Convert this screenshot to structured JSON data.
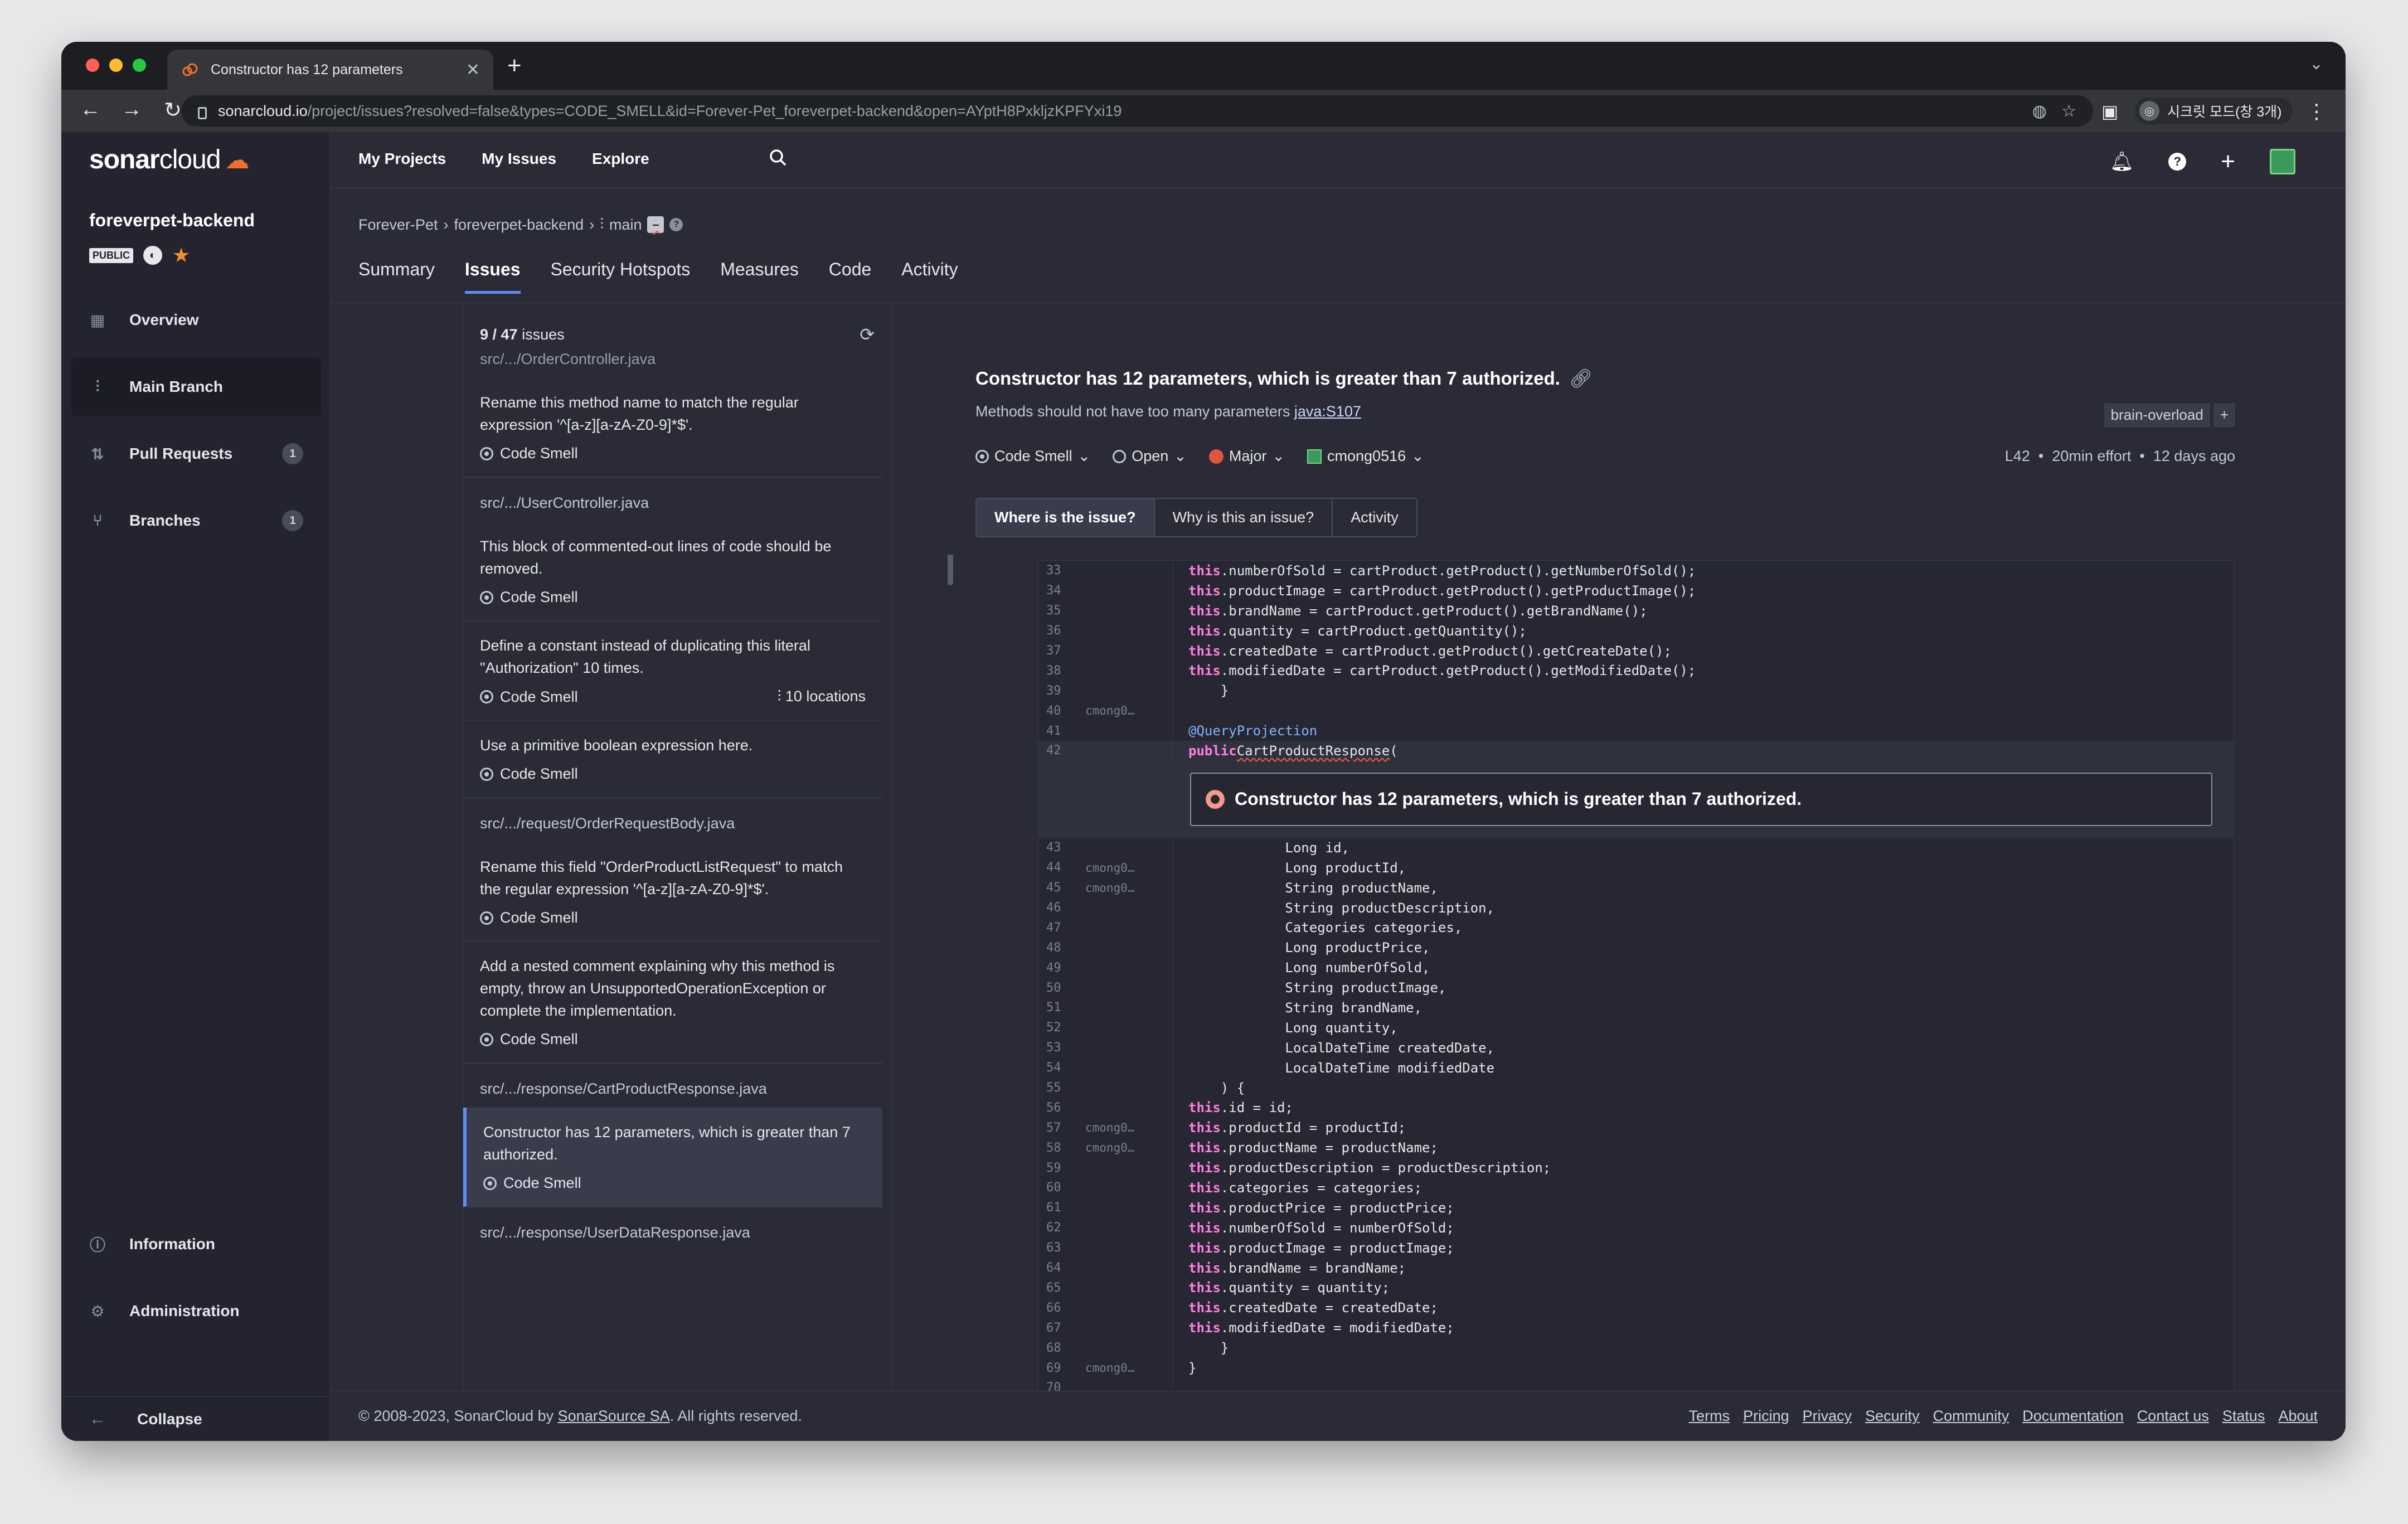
{
  "browser": {
    "tab_title": "Constructor has 12 parameters",
    "url_host": "sonarcloud.io",
    "url_rest": "/project/issues?resolved=false&types=CODE_SMELL&id=Forever-Pet_foreverpet-backend&open=AYptH8PxkljzKPFYxi19",
    "profile_label": "시크릿 모드(창 3개)"
  },
  "app": {
    "logo_bold": "sonar",
    "logo_rest": "cloud"
  },
  "topnav": {
    "links": [
      "My Projects",
      "My Issues",
      "Explore"
    ]
  },
  "sidebar": {
    "project": "foreverpet-backend",
    "badge": "PUBLIC",
    "items": [
      {
        "label": "Overview",
        "count": ""
      },
      {
        "label": "Main Branch",
        "count": ""
      },
      {
        "label": "Pull Requests",
        "count": "1"
      },
      {
        "label": "Branches",
        "count": "1"
      }
    ],
    "bottom": [
      {
        "label": "Information"
      },
      {
        "label": "Administration"
      }
    ],
    "collapse": "Collapse"
  },
  "breadcrumb": {
    "org": "Forever-Pet",
    "project": "foreverpet-backend",
    "branch": "main"
  },
  "project_tabs": [
    "Summary",
    "Issues",
    "Security Hotspots",
    "Measures",
    "Code",
    "Activity"
  ],
  "issue_list": {
    "count": "9 / 47",
    "count_suffix": "issues",
    "first_path": "src/.../OrderController.java",
    "items": [
      {
        "message": "Rename this method name to match the regular expression '^[a-z][a-zA-Z0-9]*$'.",
        "type": "Code Smell",
        "locations": ""
      },
      {
        "path": "src/.../UserController.java"
      },
      {
        "message": "This block of commented-out lines of code should be removed.",
        "type": "Code Smell",
        "locations": ""
      },
      {
        "message": "Define a constant instead of duplicating this literal \"Authorization\" 10 times.",
        "type": "Code Smell",
        "locations": "10 locations"
      },
      {
        "message": "Use a primitive boolean expression here.",
        "type": "Code Smell",
        "locations": ""
      },
      {
        "path": "src/.../request/OrderRequestBody.java"
      },
      {
        "message": "Rename this field \"OrderProductListRequest\" to match the regular expression '^[a-z][a-zA-Z0-9]*$'.",
        "type": "Code Smell",
        "locations": ""
      },
      {
        "message": "Add a nested comment explaining why this method is empty, throw an UnsupportedOperationException or complete the implementation.",
        "type": "Code Smell",
        "locations": ""
      },
      {
        "path": "src/.../response/CartProductResponse.java"
      },
      {
        "message": "Constructor has 12 parameters, which is greater than 7 authorized.",
        "type": "Code Smell",
        "locations": "",
        "selected": true
      },
      {
        "path": "src/.../response/UserDataResponse.java"
      }
    ]
  },
  "issue": {
    "title": "Constructor has 12 parameters, which is greater than 7 authorized.",
    "rule_text": "Methods should not have too many parameters",
    "rule_key": "java:S107",
    "tag": "brain-overload",
    "type": "Code Smell",
    "status": "Open",
    "severity": "Major",
    "assignee": "cmong0516",
    "line": "L42",
    "effort": "20min effort",
    "age": "12 days ago",
    "tabs": [
      "Where is the issue?",
      "Why is this an issue?",
      "Activity"
    ]
  },
  "code": {
    "before": [
      {
        "n": "33",
        "a": "",
        "t": "        this.numberOfSold = cartProduct.getProduct().getNumberOfSold();"
      },
      {
        "n": "34",
        "a": "",
        "t": "        this.productImage = cartProduct.getProduct().getProductImage();"
      },
      {
        "n": "35",
        "a": "",
        "t": "        this.brandName = cartProduct.getProduct().getBrandName();"
      },
      {
        "n": "36",
        "a": "",
        "t": "        this.quantity = cartProduct.getQuantity();"
      },
      {
        "n": "37",
        "a": "",
        "t": "        this.createdDate = cartProduct.getProduct().getCreateDate();"
      },
      {
        "n": "38",
        "a": "",
        "t": "        this.modifiedDate = cartProduct.getProduct().getModifiedDate();"
      },
      {
        "n": "39",
        "a": "",
        "t": "    }"
      },
      {
        "n": "40",
        "a": "cmong0…",
        "t": ""
      },
      {
        "n": "41",
        "a": "",
        "t": "    @QueryProjection"
      },
      {
        "n": "42",
        "a": "",
        "t": "    public CartProductResponse("
      }
    ],
    "issue_message": "Constructor has 12 parameters, which is greater than 7 authorized.",
    "after": [
      {
        "n": "43",
        "a": "",
        "t": "            Long id,"
      },
      {
        "n": "44",
        "a": "cmong0…",
        "t": "            Long productId,"
      },
      {
        "n": "45",
        "a": "cmong0…",
        "t": "            String productName,"
      },
      {
        "n": "46",
        "a": "",
        "t": "            String productDescription,"
      },
      {
        "n": "47",
        "a": "",
        "t": "            Categories categories,"
      },
      {
        "n": "48",
        "a": "",
        "t": "            Long productPrice,"
      },
      {
        "n": "49",
        "a": "",
        "t": "            Long numberOfSold,"
      },
      {
        "n": "50",
        "a": "",
        "t": "            String productImage,"
      },
      {
        "n": "51",
        "a": "",
        "t": "            String brandName,"
      },
      {
        "n": "52",
        "a": "",
        "t": "            Long quantity,"
      },
      {
        "n": "53",
        "a": "",
        "t": "            LocalDateTime createdDate,"
      },
      {
        "n": "54",
        "a": "",
        "t": "            LocalDateTime modifiedDate"
      },
      {
        "n": "55",
        "a": "",
        "t": "    ) {"
      },
      {
        "n": "56",
        "a": "",
        "t": "        this.id = id;"
      },
      {
        "n": "57",
        "a": "cmong0…",
        "t": "        this.productId = productId;"
      },
      {
        "n": "58",
        "a": "cmong0…",
        "t": "        this.productName = productName;"
      },
      {
        "n": "59",
        "a": "",
        "t": "        this.productDescription = productDescription;"
      },
      {
        "n": "60",
        "a": "",
        "t": "        this.categories = categories;"
      },
      {
        "n": "61",
        "a": "",
        "t": "        this.productPrice = productPrice;"
      },
      {
        "n": "62",
        "a": "",
        "t": "        this.numberOfSold = numberOfSold;"
      },
      {
        "n": "63",
        "a": "",
        "t": "        this.productImage = productImage;"
      },
      {
        "n": "64",
        "a": "",
        "t": "        this.brandName = brandName;"
      },
      {
        "n": "65",
        "a": "",
        "t": "        this.quantity = quantity;"
      },
      {
        "n": "66",
        "a": "",
        "t": "        this.createdDate = createdDate;"
      },
      {
        "n": "67",
        "a": "",
        "t": "        this.modifiedDate = modifiedDate;"
      },
      {
        "n": "68",
        "a": "",
        "t": "    }"
      },
      {
        "n": "69",
        "a": "cmong0…",
        "t": "}"
      },
      {
        "n": "70",
        "a": "",
        "t": ""
      }
    ]
  },
  "footer": {
    "copyright_pre": "© 2008-2023, SonarCloud by",
    "company": "SonarSource SA",
    "copyright_post": ". All rights reserved.",
    "links": [
      "Terms",
      "Pricing",
      "Privacy",
      "Security",
      "Community",
      "Documentation",
      "Contact us",
      "Status",
      "About"
    ]
  },
  "colors": {
    "accent": "#5f8df4",
    "major": "#e0553f",
    "sonar_orange": "#f3702a"
  }
}
